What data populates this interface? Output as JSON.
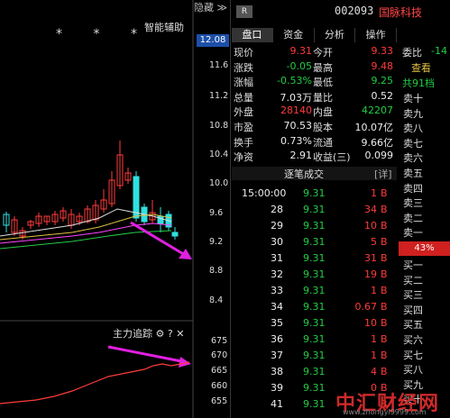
{
  "chart": {
    "assist_label": "智能辅助",
    "collapse_label": "隐藏",
    "collapse_arrows": "≫",
    "current_price_tag": "12.08",
    "price_axis": [
      "11.6",
      "11.2",
      "10.8",
      "10.4",
      "10.0",
      "9.6",
      "9.2",
      "8.8",
      "8.4"
    ],
    "markers": [
      "*",
      "*",
      "*"
    ],
    "moneyflow_title": "主力追踪",
    "moneyflow_icons": [
      "⚙",
      "?",
      "✕"
    ],
    "flow_axis": [
      "675",
      "670",
      "665",
      "660",
      "655"
    ]
  },
  "header": {
    "badge": "R",
    "code": "002093",
    "name": "国脉科技"
  },
  "tabs": [
    "盘口",
    "资金",
    "分析",
    "操作"
  ],
  "quote": {
    "rows": [
      [
        {
          "l": "现价",
          "v": "9.31",
          "c": "red"
        },
        {
          "l": "今开",
          "v": "9.33",
          "c": "red"
        }
      ],
      [
        {
          "l": "涨跌",
          "v": "-0.05",
          "c": "green"
        },
        {
          "l": "最高",
          "v": "9.48",
          "c": "red"
        }
      ],
      [
        {
          "l": "涨幅",
          "v": "-0.53%",
          "c": "green"
        },
        {
          "l": "最低",
          "v": "9.25",
          "c": "green"
        }
      ],
      [
        {
          "l": "总量",
          "v": "7.03万",
          "c": "white"
        },
        {
          "l": "量比",
          "v": "0.52",
          "c": "white"
        }
      ],
      [
        {
          "l": "外盘",
          "v": "28140",
          "c": "red"
        },
        {
          "l": "内盘",
          "v": "42207",
          "c": "green"
        }
      ],
      [
        {
          "l": "市盈",
          "v": "70.53",
          "c": "white"
        },
        {
          "l": "股本",
          "v": "10.07亿",
          "c": "white"
        }
      ],
      [
        {
          "l": "换手",
          "v": "0.73%",
          "c": "white"
        },
        {
          "l": "流通",
          "v": "9.66亿",
          "c": "white"
        }
      ],
      [
        {
          "l": "净资",
          "v": "2.91",
          "c": "white"
        },
        {
          "l": "收益(三)",
          "v": "0.099",
          "c": "white"
        }
      ]
    ]
  },
  "trades": {
    "title": "逐笔成交",
    "detail_btn": "[详]",
    "rows": [
      {
        "t": "15:00:00",
        "p": "9.31",
        "v": "1",
        "d": "B"
      },
      {
        "t": "28",
        "p": "9.31",
        "v": "34",
        "d": "B"
      },
      {
        "t": "29",
        "p": "9.31",
        "v": "10",
        "d": "B"
      },
      {
        "t": "30",
        "p": "9.31",
        "v": "5",
        "d": "B"
      },
      {
        "t": "31",
        "p": "9.31",
        "v": "31",
        "d": "B"
      },
      {
        "t": "32",
        "p": "9.31",
        "v": "19",
        "d": "B"
      },
      {
        "t": "33",
        "p": "9.31",
        "v": "1",
        "d": "B"
      },
      {
        "t": "34",
        "p": "9.31",
        "v": "0.67",
        "d": "B"
      },
      {
        "t": "35",
        "p": "9.31",
        "v": "10",
        "d": "B"
      },
      {
        "t": "36",
        "p": "9.31",
        "v": "1",
        "d": "B"
      },
      {
        "t": "37",
        "p": "9.31",
        "v": "1",
        "d": "B"
      },
      {
        "t": "38",
        "p": "9.31",
        "v": "4",
        "d": "B"
      },
      {
        "t": "39",
        "p": "9.31",
        "v": "0",
        "d": "B"
      },
      {
        "t": "41",
        "p": "9.31",
        "v": "",
        "d": "B"
      }
    ]
  },
  "orderbook": {
    "ratio_label": "委比",
    "ratio_value": "-14",
    "view_btn": "查看",
    "levels_total": "共91档",
    "sell": [
      "卖十",
      "卖九",
      "卖八",
      "卖七",
      "卖六",
      "卖五",
      "卖四",
      "卖三",
      "卖二",
      "卖一"
    ],
    "percent": "43%",
    "buy": [
      "买一",
      "买二",
      "买三",
      "买四",
      "买五",
      "买六",
      "买七",
      "买八",
      "买九",
      "买十"
    ]
  },
  "watermark": {
    "text": "中汇财经网",
    "url": "www.zhongyi9999.com"
  }
}
